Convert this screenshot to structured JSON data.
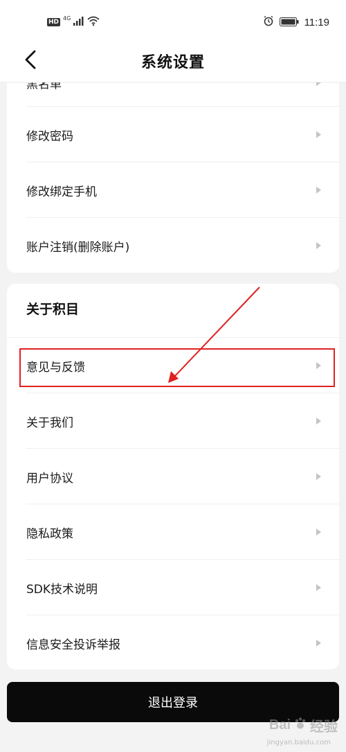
{
  "status_bar": {
    "hd": "HD",
    "network": "4G",
    "time": "11:19"
  },
  "header": {
    "title": "系统设置"
  },
  "account_section": {
    "items": [
      {
        "label": "黑名单"
      },
      {
        "label": "修改密码"
      },
      {
        "label": "修改绑定手机"
      },
      {
        "label": "账户注销(删除账户)"
      }
    ]
  },
  "about_section": {
    "title": "关于积目",
    "items": [
      {
        "label": "意见与反馈"
      },
      {
        "label": "关于我们"
      },
      {
        "label": "用户协议"
      },
      {
        "label": "隐私政策"
      },
      {
        "label": "SDK技术说明"
      },
      {
        "label": "信息安全投诉举报"
      }
    ]
  },
  "logout": {
    "label": "退出登录"
  },
  "annotation": {
    "color": "#e02020"
  },
  "watermark": {
    "brand": "Bai",
    "brand_cn": "经验",
    "url": "jingyan.baidu.com"
  }
}
